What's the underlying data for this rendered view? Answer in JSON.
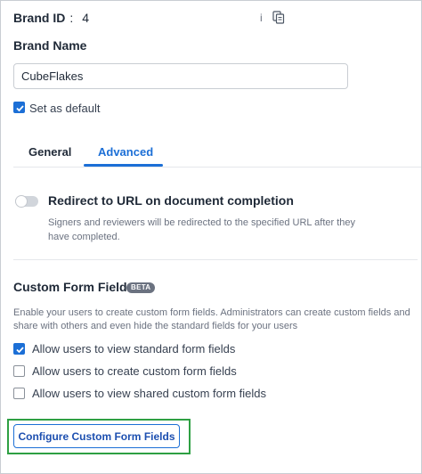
{
  "brand": {
    "id_label": "Brand ID",
    "id_colon": ":",
    "id_value": "4",
    "id_tail": "i",
    "name_label": "Brand Name",
    "name_value": "CubeFlakes",
    "set_default_label": "Set as default",
    "set_default_checked": true
  },
  "tabs": [
    {
      "label": "General",
      "active": false
    },
    {
      "label": "Advanced",
      "active": true
    }
  ],
  "redirect": {
    "title": "Redirect to URL on document completion",
    "description": "Signers and reviewers will be redirected to the specified URL after they have completed.",
    "enabled": false
  },
  "custom_form_fields": {
    "title": "Custom Form Fields",
    "badge": "BETA",
    "description": "Enable your users to create custom form fields. Administrators can create custom fields and share with others and even hide the standard fields for your users",
    "options": [
      {
        "label": "Allow users to view standard form fields",
        "checked": true
      },
      {
        "label": "Allow users to create custom form fields",
        "checked": false
      },
      {
        "label": "Allow users to view shared custom form fields",
        "checked": false
      }
    ],
    "configure_button": "Configure Custom Form Fields"
  },
  "colors": {
    "accent": "#1c6fd6",
    "highlight": "#2ea043"
  }
}
